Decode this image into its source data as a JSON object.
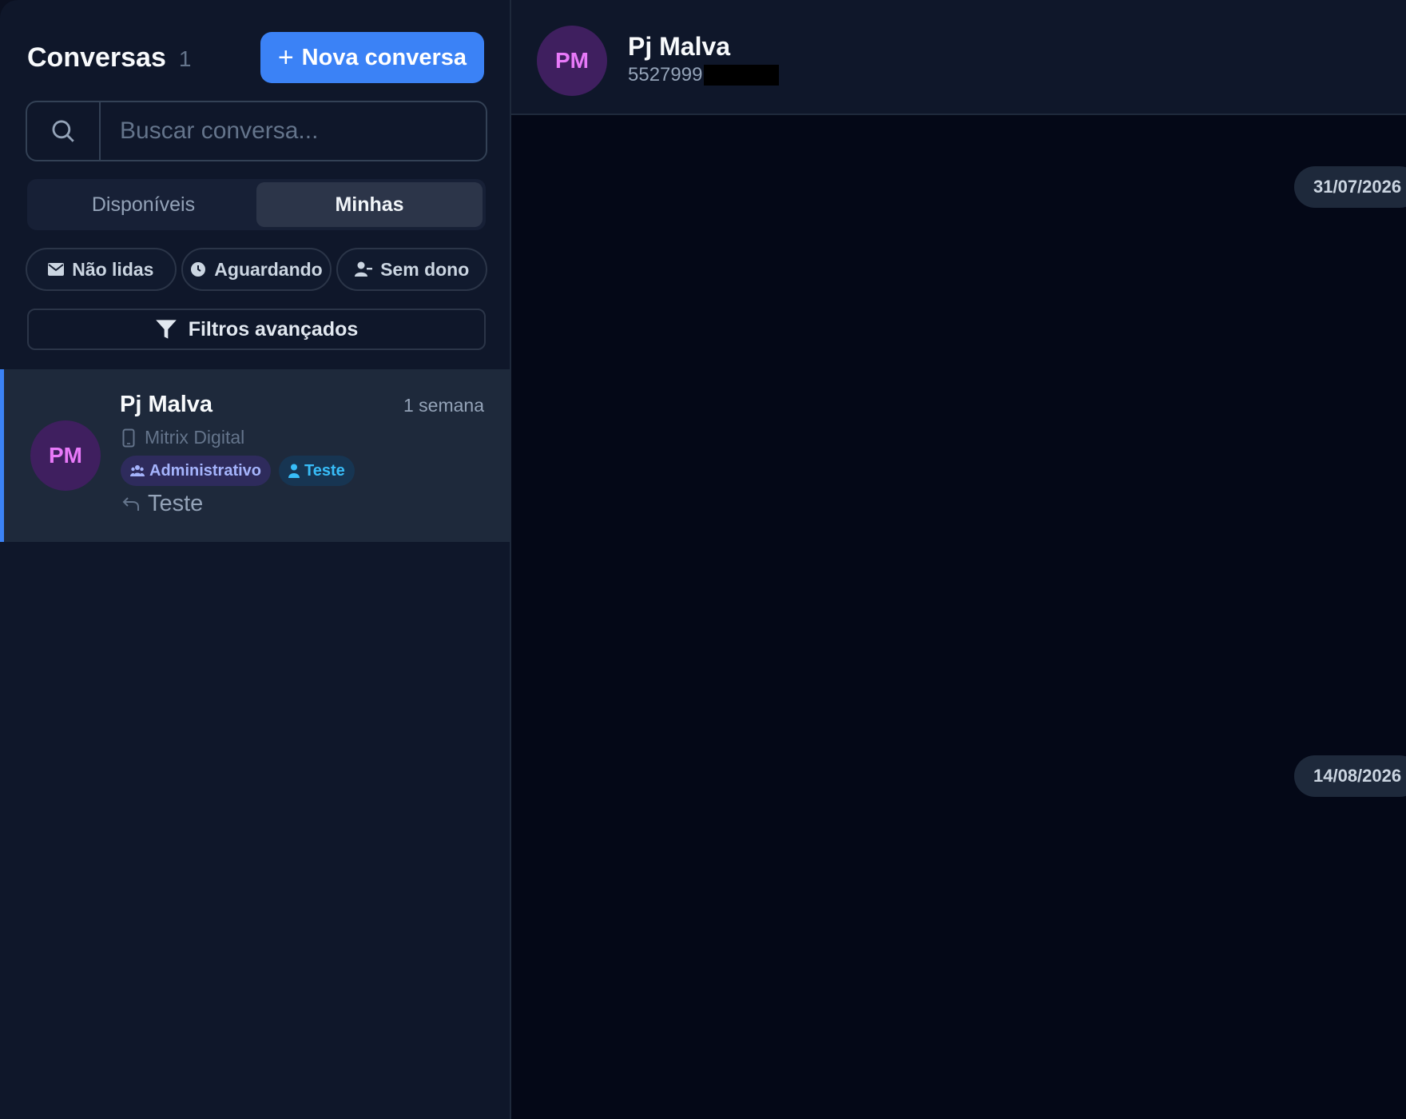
{
  "sidebar": {
    "title": "Conversas",
    "count": "1",
    "new_button": "Nova conversa",
    "search_placeholder": "Buscar conversa...",
    "tabs": [
      {
        "label": "Disponíveis",
        "active": false
      },
      {
        "label": "Minhas",
        "active": true
      }
    ],
    "filters": [
      {
        "label": "Não lidas",
        "icon": "envelope-icon"
      },
      {
        "label": "Aguardando",
        "icon": "clock-icon"
      },
      {
        "label": "Sem dono",
        "icon": "user-minus-icon"
      }
    ],
    "advanced_filters": "Filtros avançados",
    "conversations": [
      {
        "initials": "PM",
        "name": "Pj Malva",
        "time": "1 semana",
        "channel": "Mitrix Digital",
        "tags": [
          {
            "label": "Administrativo",
            "icon": "users-icon"
          },
          {
            "label": "Teste",
            "icon": "user-icon"
          }
        ],
        "last_message": "Teste",
        "selected": true
      }
    ]
  },
  "chat": {
    "initials": "PM",
    "name": "Pj Malva",
    "phone": "5527999",
    "date_separators": [
      "31/07/2026",
      "14/08/2026"
    ]
  },
  "colors": {
    "accent": "#3b82f6",
    "avatar_bg": "#3f1f5f",
    "avatar_text": "#e879f9",
    "sidebar_bg": "#0f172a",
    "chat_bg": "#040817"
  }
}
